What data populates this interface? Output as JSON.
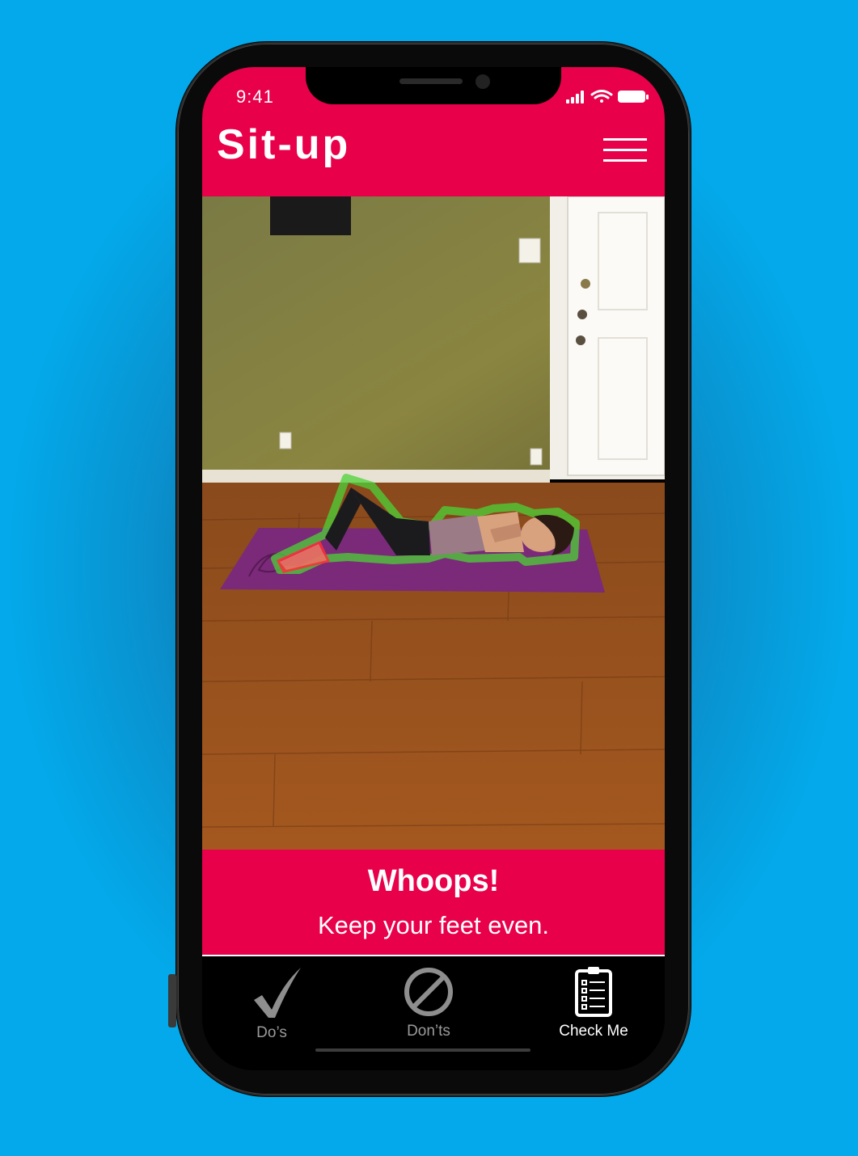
{
  "status_bar": {
    "time": "9:41"
  },
  "header": {
    "title": "Sit-up"
  },
  "feedback": {
    "title": "Whoops!",
    "message": "Keep your feet even."
  },
  "tabs": [
    {
      "label": "Do’s",
      "icon": "checkmark-icon",
      "active": false
    },
    {
      "label": "Don’ts",
      "icon": "prohibited-icon",
      "active": false
    },
    {
      "label": "Check Me",
      "icon": "clipboard-checklist-icon",
      "active": true
    }
  ],
  "colors": {
    "brand": "#e8004b",
    "background": "#03a9ea",
    "pose_ok": "#4cd137",
    "pose_error": "#ff2d3a"
  }
}
